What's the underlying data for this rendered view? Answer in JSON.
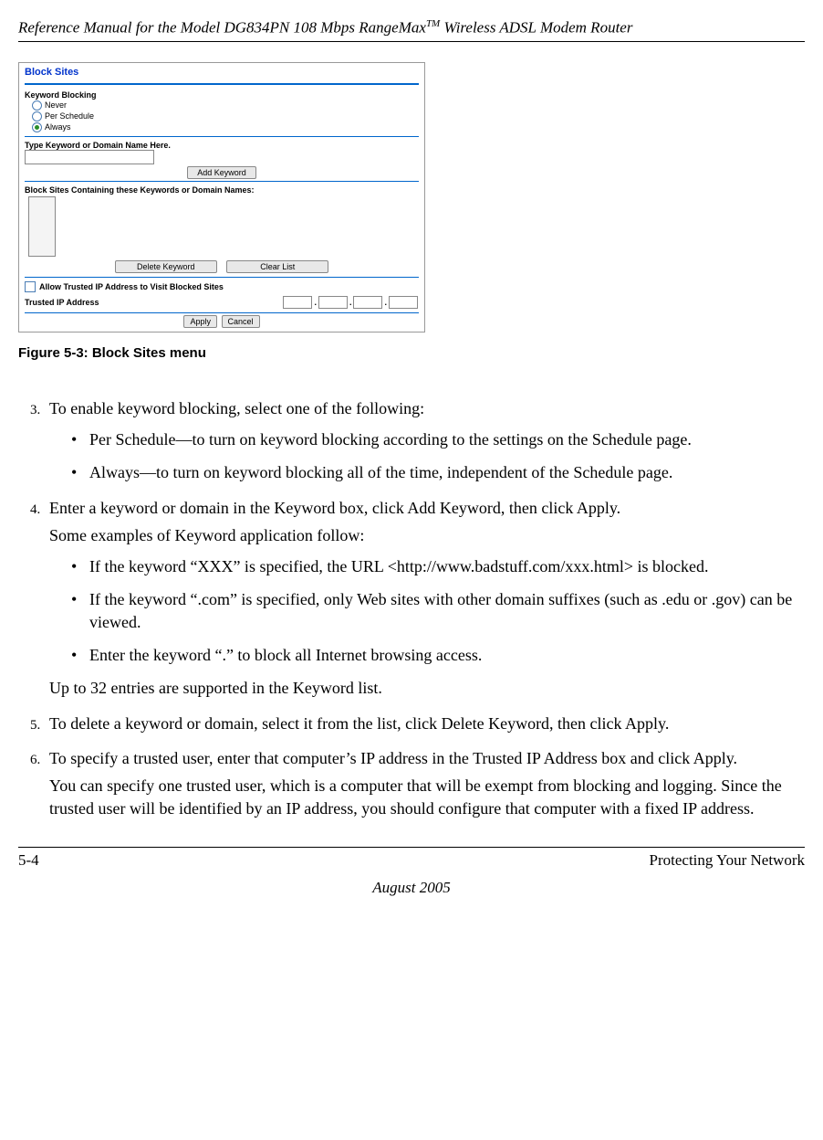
{
  "header": {
    "title_pre": "Reference Manual for the Model DG834PN 108 Mbps RangeMax",
    "title_post": " Wireless ADSL Modem Router",
    "tm": "TM"
  },
  "screenshot": {
    "title": "Block Sites",
    "keyword_blocking_label": "Keyword Blocking",
    "radios": {
      "never": "Never",
      "per_schedule": "Per Schedule",
      "always": "Always"
    },
    "type_keyword_label": "Type Keyword or Domain Name Here.",
    "add_keyword_btn": "Add Keyword",
    "containing_label": "Block Sites Containing these Keywords or Domain Names:",
    "delete_btn": "Delete Keyword",
    "clear_btn": "Clear List",
    "allow_trusted": "Allow Trusted IP Address to Visit Blocked Sites",
    "trusted_ip_label": "Trusted IP Address",
    "apply_btn": "Apply",
    "cancel_btn": "Cancel"
  },
  "figure_caption": "Figure 5-3:  Block Sites menu",
  "body": {
    "li3": "To enable keyword blocking, select one of the following:",
    "li3a": "Per Schedule—to turn on keyword blocking according to the settings on the Schedule page.",
    "li3b": "Always—to turn on keyword blocking all of the time, independent of the Schedule page.",
    "li4": "Enter a keyword or domain in the Keyword box, click Add Keyword, then click Apply.",
    "li4_p1": "Some examples of Keyword application follow:",
    "li4a": "If the keyword “XXX” is specified, the URL <http://www.badstuff.com/xxx.html> is blocked.",
    "li4b": "If the keyword “.com” is specified, only Web sites with other domain suffixes (such as .edu or .gov) can be viewed.",
    "li4c": "Enter the keyword “.” to block all Internet browsing access.",
    "li4_p2": "Up to 32 entries are supported in the Keyword list.",
    "li5": "To delete a keyword or domain, select it from the list, click Delete Keyword, then click Apply.",
    "li6": "To specify a trusted user, enter that computer’s IP address in the Trusted IP Address box and click Apply.",
    "li6_p1": "You can specify one trusted user, which is a computer that will be exempt from blocking and logging. Since the trusted user will be identified by an IP address, you should configure that computer with a fixed IP address."
  },
  "footer": {
    "page_num": "5-4",
    "section": "Protecting Your Network",
    "date": "August 2005"
  }
}
